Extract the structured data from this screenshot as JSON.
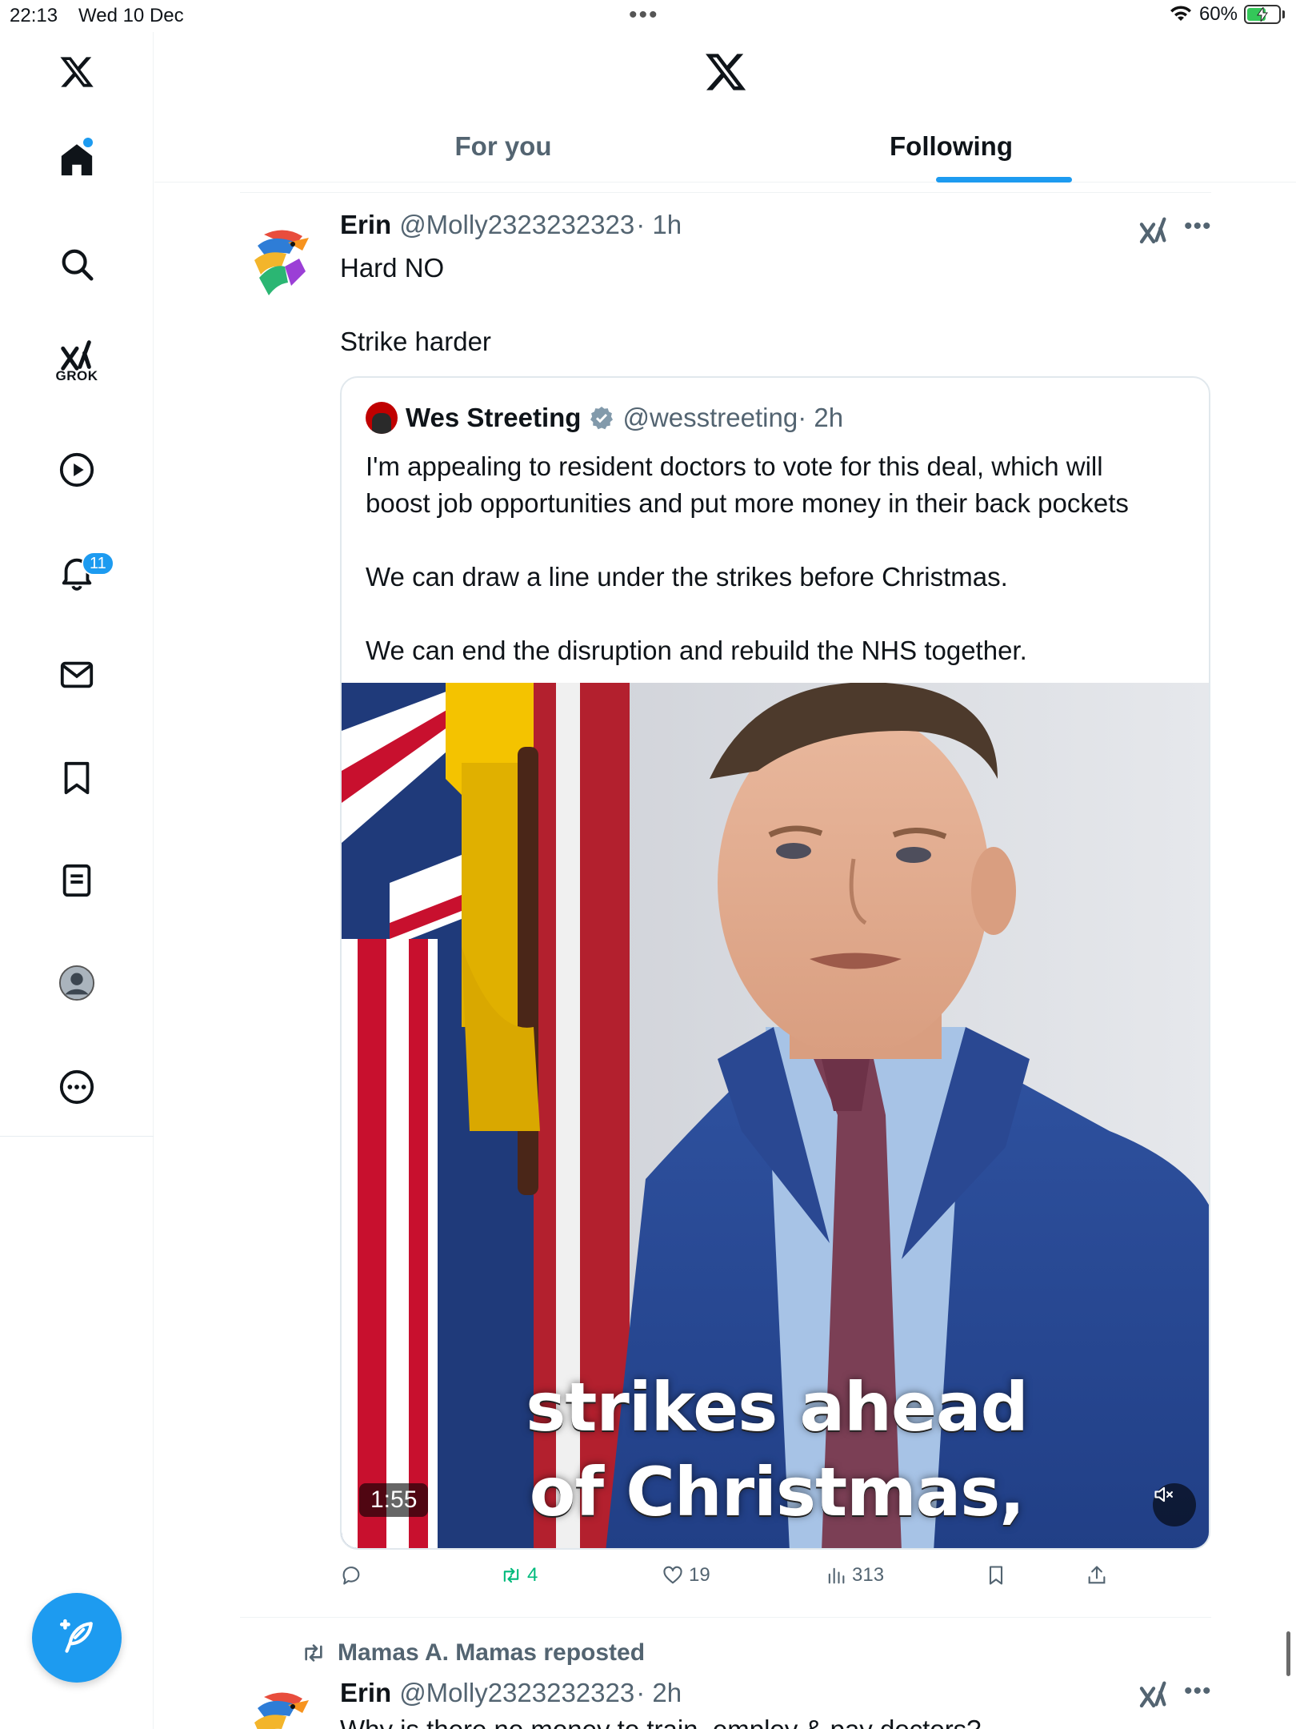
{
  "status_bar": {
    "time": "22:13",
    "date": "Wed 10 Dec",
    "battery": "60%",
    "battery_level": 0.6,
    "battery_color": "#34c759"
  },
  "sidebar": {
    "items": [
      {
        "name": "home",
        "icon": "home-icon",
        "active": true
      },
      {
        "name": "explore",
        "icon": "search-icon"
      },
      {
        "name": "grok",
        "icon": "grok-icon",
        "label": "GROK"
      },
      {
        "name": "videos",
        "icon": "play-icon"
      },
      {
        "name": "notifications",
        "icon": "bell-icon",
        "badge": "11"
      },
      {
        "name": "messages",
        "icon": "mail-icon"
      },
      {
        "name": "bookmarks",
        "icon": "bookmark-icon"
      },
      {
        "name": "articles",
        "icon": "document-icon"
      },
      {
        "name": "profile",
        "icon": "avatar-icon"
      },
      {
        "name": "more",
        "icon": "more-circle-icon"
      }
    ],
    "compose_icon": "compose-feather-icon"
  },
  "header": {
    "logo": "x-logo-icon",
    "tabs": [
      {
        "label": "For you",
        "selected": false
      },
      {
        "label": "Following",
        "selected": true
      }
    ],
    "accent_color": "#1d9bf0"
  },
  "posts": [
    {
      "author": "Erin",
      "handle": "@Molly2323232323",
      "time": "· 1h",
      "text": [
        "Hard NO",
        "",
        "Strike harder"
      ],
      "quote": {
        "author": "Wes Streeting",
        "verified": true,
        "handle": "@wesstreeting",
        "time": "· 2h",
        "text": [
          "I'm appealing to resident doctors to vote for this deal, which will",
          "boost job opportunities and put more money in their back pockets",
          "",
          "We can draw a line under the strikes before Christmas.",
          "",
          "We can end the disruption and rebuild the NHS together."
        ],
        "video": {
          "caption_line1": "strikes ahead",
          "caption_line2": "of Christmas,",
          "duration": "1:55",
          "muted": true
        }
      },
      "actions": {
        "replies": "",
        "reposts": "4",
        "reposted": true,
        "likes": "19",
        "views": "313"
      }
    },
    {
      "repost_label": "Mamas A. Mamas reposted",
      "author": "Erin",
      "handle": "@Molly2323232323",
      "time": "· 2h",
      "text_partial": "Why is there no money to train, employ & pay doctors?"
    }
  ],
  "colors": {
    "text_primary": "#0f1419",
    "text_secondary": "#536471",
    "repost_green": "#00ba7c"
  }
}
